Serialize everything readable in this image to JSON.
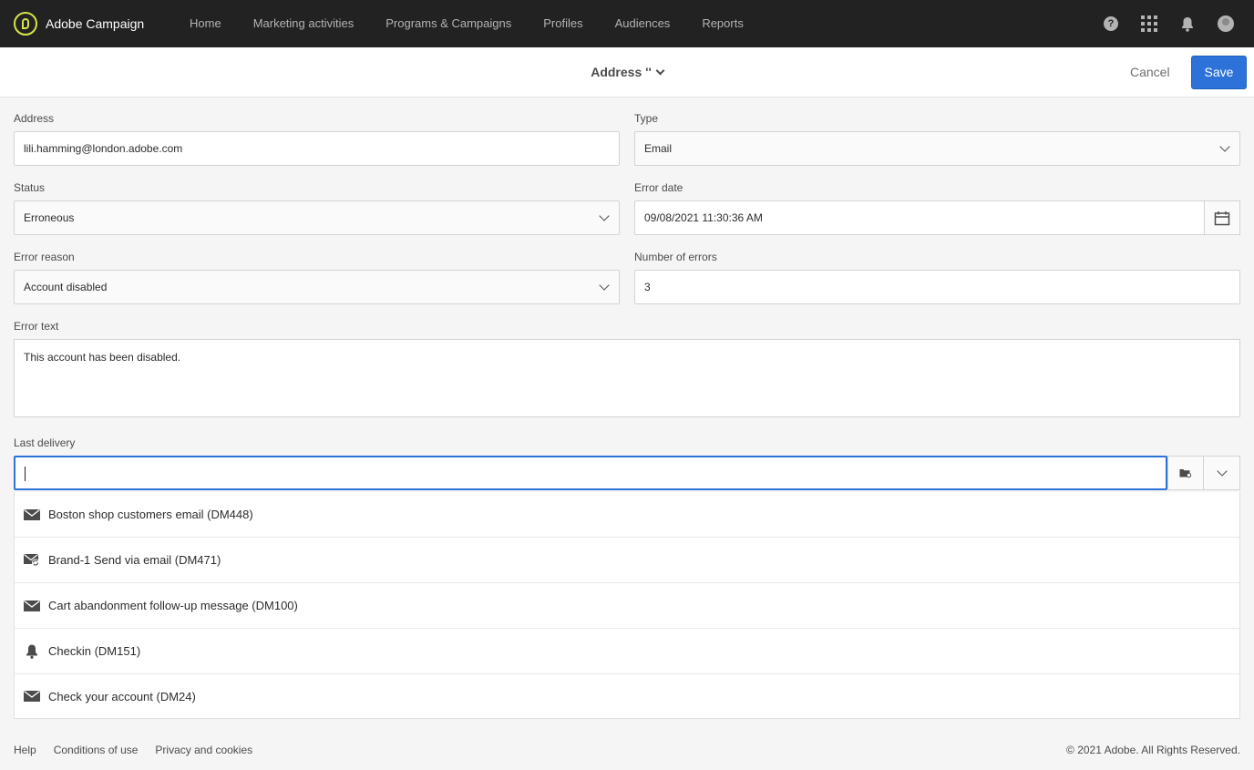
{
  "app": {
    "name": "Adobe Campaign"
  },
  "nav": {
    "items": [
      "Home",
      "Marketing activities",
      "Programs & Campaigns",
      "Profiles",
      "Audiences",
      "Reports"
    ],
    "right_icons": [
      "help-icon",
      "apps-icon",
      "bell-icon",
      "avatar"
    ]
  },
  "header": {
    "title": "Address ''",
    "cancel_label": "Cancel",
    "save_label": "Save"
  },
  "form": {
    "address": {
      "label": "Address",
      "value": "lili.hamming@london.adobe.com"
    },
    "type": {
      "label": "Type",
      "value": "Email"
    },
    "status": {
      "label": "Status",
      "value": "Erroneous"
    },
    "error_date": {
      "label": "Error date",
      "value": "09/08/2021 11:30:36 AM"
    },
    "error_reason": {
      "label": "Error reason",
      "value": "Account disabled"
    },
    "number_of_errors": {
      "label": "Number of errors",
      "value": "3"
    },
    "error_text": {
      "label": "Error text",
      "value": "This account has been disabled."
    },
    "last_delivery": {
      "label": "Last delivery",
      "value": ""
    }
  },
  "dropdown": {
    "items": [
      {
        "label": "Boston shop customers email (DM448)",
        "icon": "envelope-icon"
      },
      {
        "label": "Brand-1 Send via email (DM471)",
        "icon": "recurring-email-icon"
      },
      {
        "label": "Cart abandonment follow-up message (DM100)",
        "icon": "envelope-icon"
      },
      {
        "label": "Checkin (DM151)",
        "icon": "push-bell-icon"
      },
      {
        "label": "Check your account (DM24)",
        "icon": "envelope-icon"
      }
    ]
  },
  "footer": {
    "links": [
      "Help",
      "Conditions of use",
      "Privacy and cookies"
    ],
    "copyright": "© 2021 Adobe. All Rights Reserved."
  },
  "colors": {
    "topbar": "#222222",
    "accent": "#2d72d9",
    "logo": "#d6e545"
  }
}
